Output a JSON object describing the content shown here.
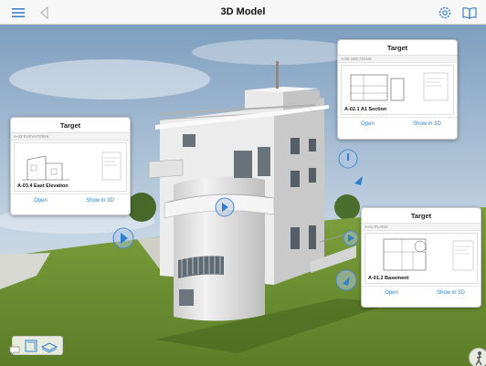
{
  "header": {
    "title": "3D Model",
    "icons": {
      "menu": "hamburger-menu-icon",
      "back": "back-triangle-icon",
      "settings": "gear-icon",
      "book": "open-book-icon"
    }
  },
  "cards": {
    "sections": {
      "title": "Target",
      "sheet_group": "A-02 SECTIONS",
      "sheet_name": "A-02.1 A1 Section",
      "open_label": "Open",
      "show3d_label": "Show in 3D"
    },
    "elevations": {
      "title": "Target",
      "sheet_group": "A-03 ELEVATIONS",
      "sheet_name": "A-03.4 East Elevation",
      "open_label": "Open",
      "show3d_label": "Show in 3D"
    },
    "plans": {
      "title": "Target",
      "sheet_group": "A-01 PLANS",
      "sheet_name": "A-01.2 Basement",
      "open_label": "Open",
      "show3d_label": "Show in 3D"
    }
  },
  "colors": {
    "accent": "#2d7fd0",
    "grass": "#6f9233",
    "sky": "#a9c0d6",
    "building": "#e6e6e6"
  }
}
